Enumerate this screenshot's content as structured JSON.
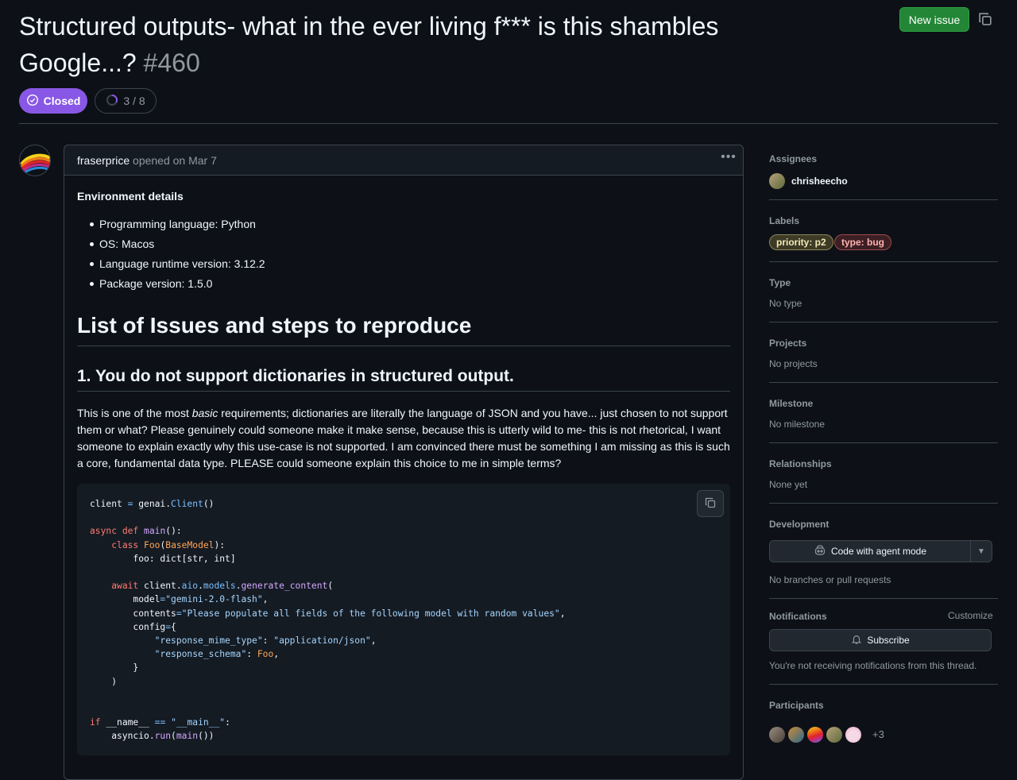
{
  "issue": {
    "title": "Structured outputs- what in the ever living f*** is this shambles Google...?",
    "number": "#460",
    "state": "Closed",
    "subissue_progress": "3 / 8",
    "new_issue_label": "New issue"
  },
  "comment": {
    "author": "fraserprice",
    "meta": "opened on Mar 7",
    "env_heading": "Environment details",
    "env_items": [
      "Programming language: Python",
      "OS: Macos",
      "Language runtime version: 3.12.2",
      "Package version: 1.5.0"
    ],
    "h1": "List of Issues and steps to reproduce",
    "h2": "1. You do not support dictionaries in structured output.",
    "para_before": "This is one of the most ",
    "para_em": "basic",
    "para_after": " requirements; dictionaries are literally the language of JSON and you have... just chosen to not support them or what? Please genuinely could someone make it make sense, because this is utterly wild to me- this is not rhetorical, I want someone to explain exactly why this use-case is not supported. I am convinced there must be something I am missing as this is such a core, fundamental data type. PLEASE could someone explain this choice to me in simple terms?",
    "code": "client = genai.Client()\n\nasync def main():\n    class Foo(BaseModel):\n        foo: dict[str, int]\n\n    await client.aio.models.generate_content(\n        model=\"gemini-2.0-flash\",\n        contents=\"Please populate all fields of the following model with random values\",\n        config={\n            \"response_mime_type\": \"application/json\",\n            \"response_schema\": Foo,\n        }\n    )\n\n\nif __name__ == \"__main__\":\n    asyncio.run(main())"
  },
  "sidebar": {
    "assignees": {
      "heading": "Assignees",
      "name": "chrisheecho"
    },
    "labels": {
      "heading": "Labels",
      "items": [
        "priority: p2",
        "type: bug"
      ]
    },
    "type": {
      "heading": "Type",
      "value": "No type"
    },
    "projects": {
      "heading": "Projects",
      "value": "No projects"
    },
    "milestone": {
      "heading": "Milestone",
      "value": "No milestone"
    },
    "relationships": {
      "heading": "Relationships",
      "value": "None yet"
    },
    "development": {
      "heading": "Development",
      "button": "Code with agent mode",
      "value": "No branches or pull requests"
    },
    "notifications": {
      "heading": "Notifications",
      "customize": "Customize",
      "subscribe": "Subscribe",
      "note": "You're not receiving notifications from this thread."
    },
    "participants": {
      "heading": "Participants",
      "more": "+3"
    }
  },
  "colors": {
    "closed_badge": "#8957e5",
    "new_issue_button": "#238636",
    "background": "#0d1117"
  },
  "icons": [
    "copy-icon",
    "check-circle-icon",
    "progress-ring-icon",
    "kebab-icon",
    "copilot-icon",
    "caret-down-icon",
    "bell-icon"
  ]
}
